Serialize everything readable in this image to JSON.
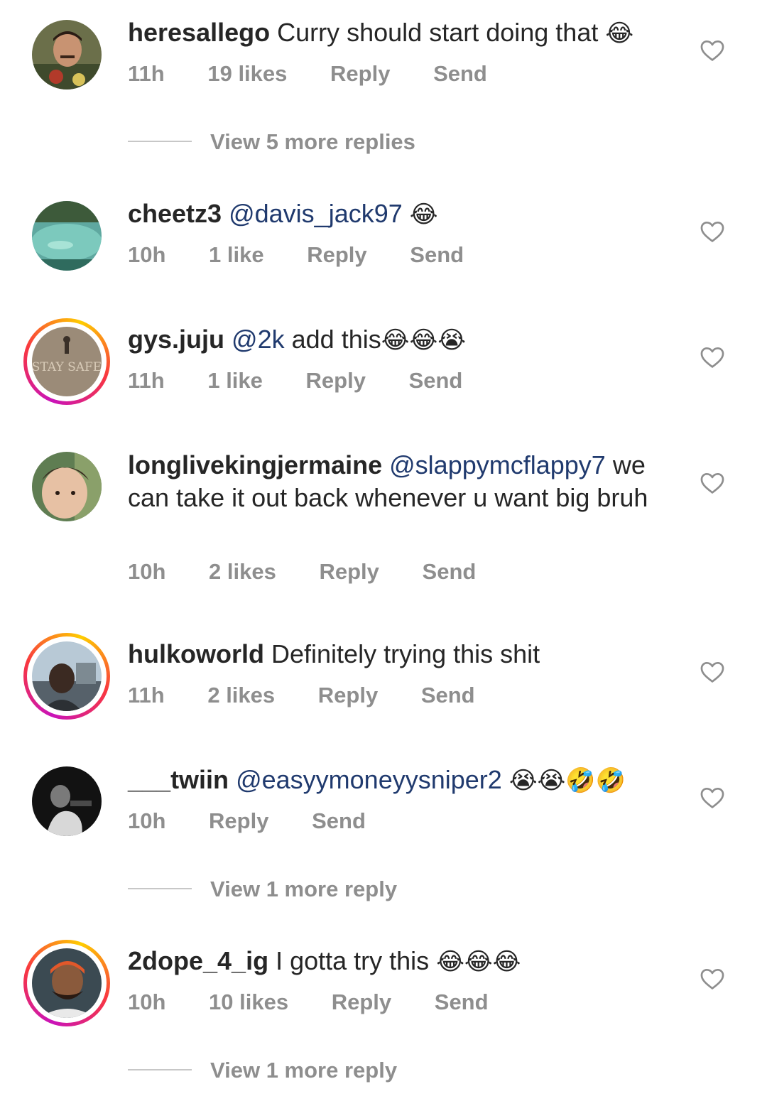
{
  "comments": [
    {
      "username": "heresallego",
      "mention": "",
      "text": "Curry should start doing that",
      "emoji": "😂",
      "time": "11h",
      "likes": "19 likes",
      "reply": "Reply",
      "send": "Send",
      "view_replies": "View 5 more replies"
    },
    {
      "username": "cheetz3",
      "mention": "@davis_jack97",
      "text": "",
      "emoji": "😂",
      "time": "10h",
      "likes": "1 like",
      "reply": "Reply",
      "send": "Send"
    },
    {
      "username": "gys.juju",
      "mention": "@2k",
      "text": "add this",
      "emoji": "😂😂😭",
      "time": "11h",
      "likes": "1 like",
      "reply": "Reply",
      "send": "Send",
      "avatar_text": "STAY SAFE"
    },
    {
      "username": "longlivekingjermaine",
      "mention": "@slappymcflappy7",
      "text": "we can take it out back whenever u want big bruh",
      "emoji": "",
      "time": "10h",
      "likes": "2 likes",
      "reply": "Reply",
      "send": "Send"
    },
    {
      "username": "hulkoworld",
      "mention": "",
      "text": "Definitely trying this shit",
      "emoji": "",
      "time": "11h",
      "likes": "2 likes",
      "reply": "Reply",
      "send": "Send"
    },
    {
      "username": "___twiin",
      "mention": "@easyymoneyysniper2",
      "text": "",
      "emoji": "😭😭🤣🤣",
      "time": "10h",
      "likes": "",
      "reply": "Reply",
      "send": "Send",
      "view_replies": "View 1 more reply"
    },
    {
      "username": "2dope_4_ig",
      "mention": "",
      "text": "I gotta try this",
      "emoji": "😂😂😂",
      "time": "10h",
      "likes": "10 likes",
      "reply": "Reply",
      "send": "Send",
      "view_replies": "View 1 more reply"
    }
  ],
  "icons": {
    "like": "heart-outline-icon"
  },
  "colors": {
    "text": "#262626",
    "meta": "#8e8e8e",
    "mention": "#203a6e",
    "story_ring": [
      "#c913b9",
      "#f9373f",
      "#fecd00"
    ]
  }
}
